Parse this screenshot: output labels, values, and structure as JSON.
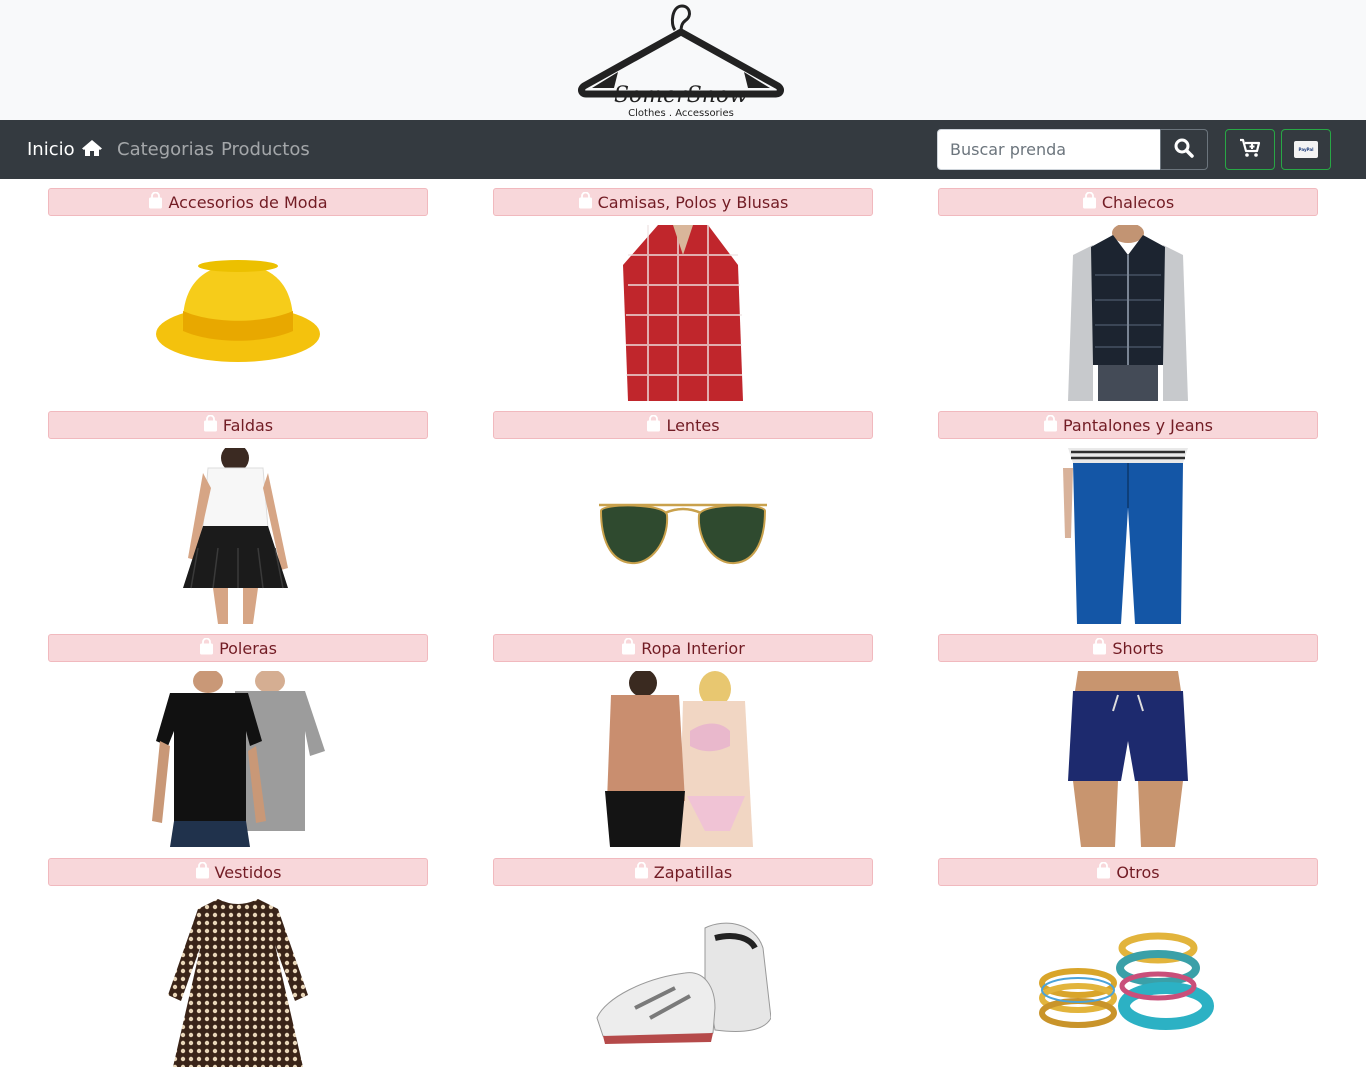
{
  "brand": {
    "name": "SomerSnow",
    "tagline": "Clothes . Accessories"
  },
  "nav": {
    "home": "Inicio",
    "categories": "Categorias",
    "products": "Productos"
  },
  "search": {
    "placeholder": "Buscar prenda",
    "value": ""
  },
  "paypal_label": "PayPal",
  "categories": [
    {
      "label": "Accesorios de Moda",
      "image": "yellow-fedora-hat"
    },
    {
      "label": "Camisas, Polos y Blusas",
      "image": "red-plaid-shirt"
    },
    {
      "label": "Chalecos",
      "image": "black-puffer-vest"
    },
    {
      "label": "Faldas",
      "image": "black-fringe-skirt"
    },
    {
      "label": "Lentes",
      "image": "aviator-sunglasses"
    },
    {
      "label": "Pantalones y Jeans",
      "image": "blue-jeans"
    },
    {
      "label": "Poleras",
      "image": "t-shirts"
    },
    {
      "label": "Ropa Interior",
      "image": "underwear"
    },
    {
      "label": "Shorts",
      "image": "navy-shorts"
    },
    {
      "label": "Vestidos",
      "image": "polka-dot-dress"
    },
    {
      "label": "Zapatillas",
      "image": "running-sneakers"
    },
    {
      "label": "Otros",
      "image": "bangles"
    }
  ],
  "colors": {
    "navbar": "#343a40",
    "badge_bg": "#f8d7da",
    "badge_text": "#721c24",
    "outline_success": "#28a745"
  }
}
